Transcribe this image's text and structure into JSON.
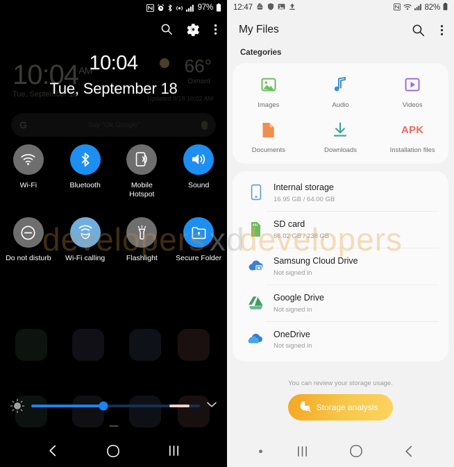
{
  "watermark": {
    "part1": "developers",
    "part2": "xd",
    "part3": "developers"
  },
  "left_panel": {
    "statusbar": {
      "icons": [
        "nfc-icon",
        "alarm-icon",
        "bluetooth-icon",
        "hotspot-icon",
        "signal-icon"
      ],
      "battery_percent": "97%"
    },
    "header_icons": [
      "search-icon",
      "settings-gear-icon",
      "more-options-icon"
    ],
    "clock": {
      "time": "10:04",
      "date": "Tue, September 18"
    },
    "ghost": {
      "time": "10:04",
      "ampm": "AM",
      "date": "Tue, September 18",
      "temperature": "66°",
      "city": "Oxnard",
      "updated": "Updated 9/18 10:02 AM",
      "search_hint": "Say \"Ok Google\""
    },
    "tiles": [
      {
        "label": "Wi-Fi",
        "icon": "wifi-icon",
        "state": "off"
      },
      {
        "label": "Bluetooth",
        "icon": "bluetooth-icon",
        "state": "on"
      },
      {
        "label": "Mobile Hotspot",
        "icon": "hotspot-icon",
        "state": "off"
      },
      {
        "label": "Sound",
        "icon": "sound-icon",
        "state": "on"
      },
      {
        "label": "Do not disturb",
        "icon": "do-not-disturb-icon",
        "state": "off"
      },
      {
        "label": "Wi-Fi calling",
        "icon": "wifi-calling-icon",
        "state": "on-soft"
      },
      {
        "label": "Flashlight",
        "icon": "flashlight-icon",
        "state": "off"
      },
      {
        "label": "Secure Folder",
        "icon": "secure-folder-icon",
        "state": "on"
      }
    ],
    "brightness": {
      "value": 43,
      "icon": "brightness-icon",
      "expand_icon": "chevron-down-icon"
    },
    "navbar": [
      "back-icon",
      "home-icon",
      "recents-icon"
    ],
    "colors": {
      "accent_on": "#1d8ff2",
      "accent_off": "#6e6e6e",
      "slider": "#1a84f0"
    }
  },
  "right_panel": {
    "statusbar": {
      "time": "12:47",
      "left_icons": [
        "google-drive-icon",
        "shield-icon",
        "image-icon",
        "upload-icon"
      ],
      "right_icons": [
        "nfc-icon",
        "wifi-icon",
        "signal-icon"
      ],
      "battery_percent": "82%"
    },
    "header": {
      "title": "My Files",
      "icons": [
        "search-icon",
        "more-options-icon"
      ]
    },
    "categories": {
      "section_title": "Categories",
      "items": [
        {
          "label": "Images",
          "icon": "images-icon",
          "color": "#6bbf59"
        },
        {
          "label": "Audio",
          "icon": "audio-icon",
          "color": "#3d8fd1"
        },
        {
          "label": "Videos",
          "icon": "videos-icon",
          "color": "#9a6ee0"
        },
        {
          "label": "Documents",
          "icon": "documents-icon",
          "color": "#ef8f4e"
        },
        {
          "label": "Downloads",
          "icon": "downloads-icon",
          "color": "#3aa39a"
        },
        {
          "label": "Installation files",
          "icon": "apk-icon",
          "color": "#ec6a5e",
          "text": "APK"
        }
      ]
    },
    "storage": [
      {
        "name": "Internal storage",
        "sub": "16.95 GB / 64.00 GB",
        "icon": "phone-icon"
      },
      {
        "name": "SD card",
        "sub": "66.02 GB / 238 GB",
        "icon": "sd-card-icon"
      },
      {
        "name": "Samsung Cloud Drive",
        "sub": "Not signed in",
        "icon": "samsung-cloud-icon"
      },
      {
        "name": "Google Drive",
        "sub": "Not signed in",
        "icon": "google-drive-icon"
      },
      {
        "name": "OneDrive",
        "sub": "Not signed in",
        "icon": "onedrive-icon"
      }
    ],
    "footer": {
      "note": "You can review your storage usage.",
      "button_label": "Storage analysis",
      "button_icon": "storage-analysis-icon"
    },
    "navbar": [
      "page-dot",
      "recents-icon",
      "home-icon",
      "back-icon"
    ]
  }
}
